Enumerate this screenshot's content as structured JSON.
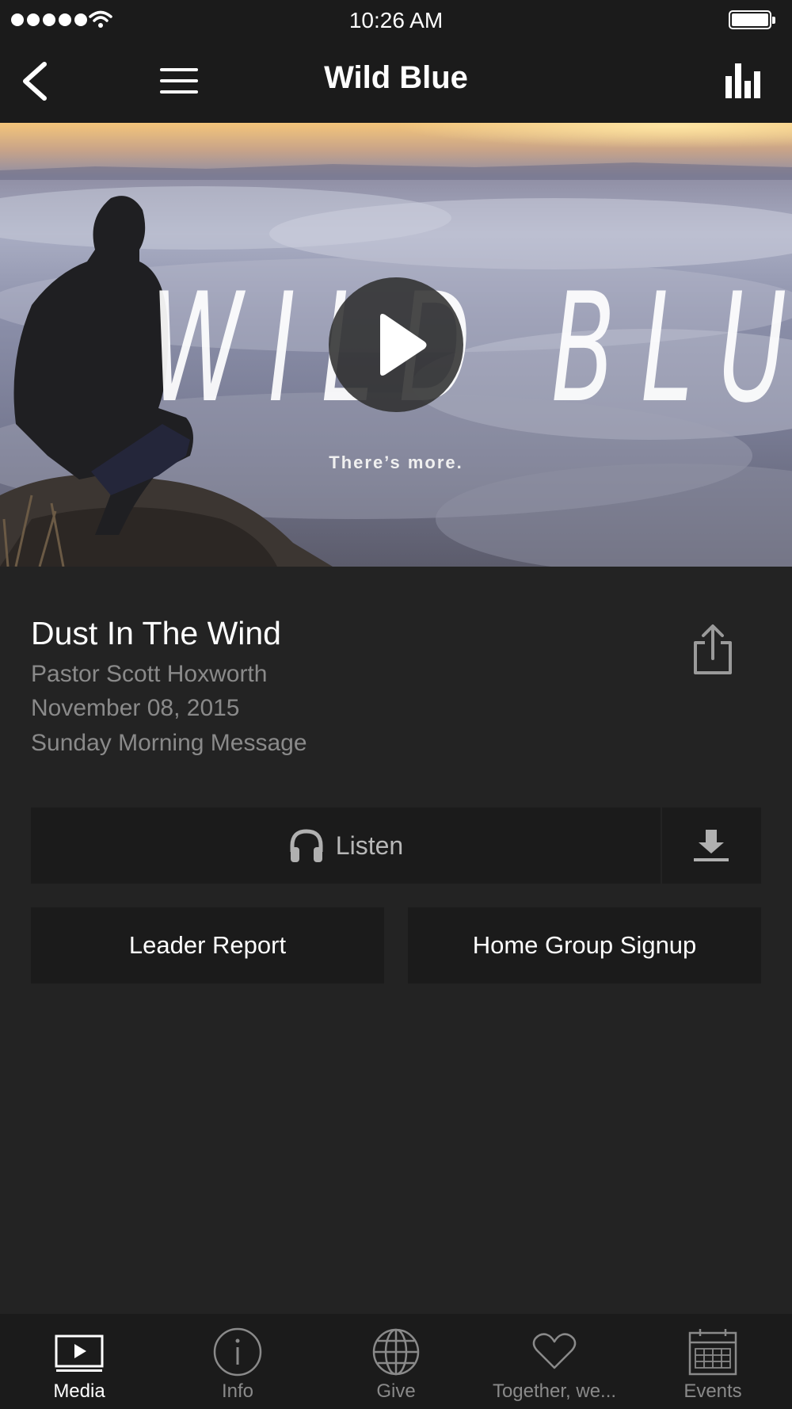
{
  "status_bar": {
    "time": "10:26 AM",
    "signal_icon": "signal-dots-icon",
    "wifi_icon": "wifi-icon",
    "battery_icon": "battery-icon"
  },
  "nav": {
    "title": "Wild Blue",
    "back_icon": "chevron-left-icon",
    "menu_icon": "hamburger-menu-icon",
    "stats_icon": "bar-chart-icon"
  },
  "hero": {
    "title": "WILD BLUE",
    "tagline": "There’s more.",
    "play_icon": "play-icon"
  },
  "sermon": {
    "title": "Dust In The Wind",
    "speaker": "Pastor Scott Hoxworth",
    "date": "November 08, 2015",
    "series": "Sunday Morning Message",
    "share_icon": "share-icon"
  },
  "actions": {
    "listen_label": "Listen",
    "listen_icon": "headphones-icon",
    "download_icon": "download-icon",
    "leader_report_label": "Leader Report",
    "home_group_label": "Home Group Signup"
  },
  "tab_bar": {
    "active_tab": "Media",
    "tabs": [
      {
        "label": "Media",
        "icon": "tv-play-icon"
      },
      {
        "label": "Info",
        "icon": "info-icon"
      },
      {
        "label": "Give",
        "icon": "globe-icon"
      },
      {
        "label": "Together, we...",
        "icon": "heart-icon"
      },
      {
        "label": "Events",
        "icon": "calendar-icon"
      }
    ]
  },
  "colors": {
    "background": "#232323",
    "bar_background": "#1b1b1b",
    "button_background": "#1b1b1b",
    "secondary_text": "#8a8a8a",
    "primary_text": "#ffffff"
  }
}
